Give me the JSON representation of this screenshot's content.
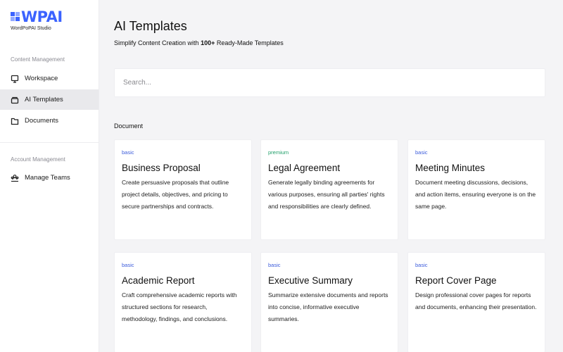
{
  "brand": {
    "logo_text": "WPAI",
    "sub": "WordPoPAI Studio",
    "color": "#3b63ff"
  },
  "sidebar": {
    "content_label": "Content Management",
    "items": [
      {
        "label": "Workspace",
        "icon": "monitor-icon"
      },
      {
        "label": "AI Templates",
        "icon": "template-icon",
        "active": true
      },
      {
        "label": "Documents",
        "icon": "folder-icon"
      }
    ],
    "account_label": "Account Management",
    "account_items": [
      {
        "label": "Manage Teams",
        "icon": "teams-icon"
      }
    ]
  },
  "header": {
    "title": "AI Templates",
    "subtitle_pre": "Simplify Content Creation with ",
    "subtitle_bold": "100+",
    "subtitle_post": " Ready-Made Templates"
  },
  "search": {
    "placeholder": "Search..."
  },
  "category": "Document",
  "cards": [
    {
      "badge": "basic",
      "title": "Business Proposal",
      "desc": "Create persuasive proposals that outline project details, objectives, and pricing to secure partnerships and contracts."
    },
    {
      "badge": "premium",
      "title": "Legal Agreement",
      "desc": "Generate legally binding agreements for various purposes, ensuring all parties' rights and responsibilities are clearly defined."
    },
    {
      "badge": "basic",
      "title": "Meeting Minutes",
      "desc": "Document meeting discussions, decisions, and action items, ensuring everyone is on the same page."
    },
    {
      "badge": "basic",
      "title": "Academic Report",
      "desc": "Craft comprehensive academic reports with structured sections for research, methodology, findings, and conclusions."
    },
    {
      "badge": "basic",
      "title": "Executive Summary",
      "desc": "Summarize extensive documents and reports into concise, informative executive summaries."
    },
    {
      "badge": "basic",
      "title": "Report Cover Page",
      "desc": "Design professional cover pages for reports and documents, enhancing their presentation."
    }
  ]
}
